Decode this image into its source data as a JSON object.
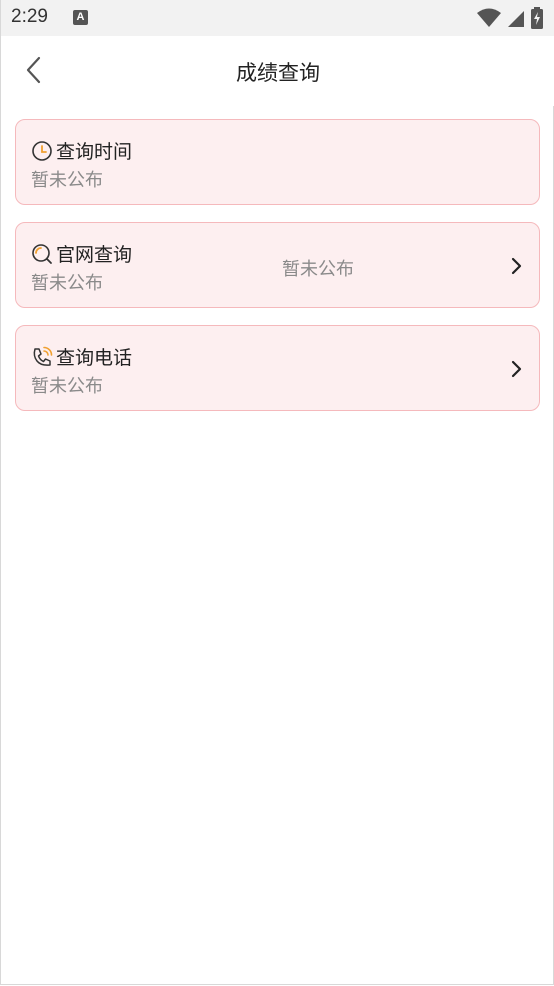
{
  "status_bar": {
    "time": "2:29",
    "notification_badge": "A",
    "icons": [
      "wifi-icon",
      "cell-signal-icon",
      "battery-charging-icon"
    ]
  },
  "app_bar": {
    "title": "成绩查询",
    "back_icon": "back-arrow-icon"
  },
  "cards": [
    {
      "id": "query-time",
      "icon": "clock-icon",
      "title": "查询时间",
      "subtitle": "暂未公布",
      "middle_text": "",
      "has_chevron": false
    },
    {
      "id": "official-site",
      "icon": "search-icon",
      "title": "官网查询",
      "subtitle": "暂未公布",
      "middle_text": "暂未公布",
      "has_chevron": true
    },
    {
      "id": "query-phone",
      "icon": "phone-icon",
      "title": "查询电话",
      "subtitle": "暂未公布",
      "middle_text": "",
      "has_chevron": true
    }
  ],
  "colors": {
    "card_background": "#fdeff0",
    "card_border": "#f5b9bc",
    "icon_accent": "#f0a030",
    "icon_stroke": "#333333"
  }
}
